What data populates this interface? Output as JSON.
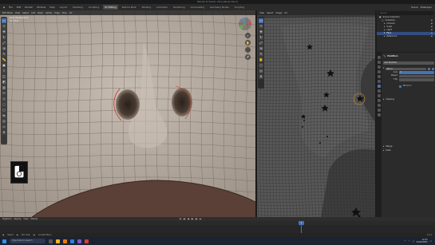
{
  "window": {
    "title": "Blender [C:\\Users\\...\\Face_Retopo.blend]"
  },
  "topbar": {
    "menus": [
      "File",
      "Edit",
      "Render",
      "Window",
      "Help"
    ],
    "workspaces": [
      "Layout",
      "Modeling",
      "Sculpting",
      "UV Editing",
      "Texture Paint",
      "Shading",
      "Animation",
      "Rendering",
      "Compositing",
      "Geometry Nodes",
      "Scripting"
    ],
    "active_workspace": "UV Editing",
    "scene_label": "Scene",
    "view_layer_label": "ViewLayer"
  },
  "viewport": {
    "header_items": [
      "Edit Mode",
      "View",
      "Select",
      "Add",
      "Mesh",
      "Vertex",
      "Edge",
      "Face",
      "UV"
    ],
    "overlay_line1": "User Perspective",
    "overlay_line2": "(1) Face",
    "colors": {
      "skin": "#b6ab9f",
      "wire": "#6e655c",
      "seam": "#c0392b",
      "mouth": "#5a4036"
    }
  },
  "uv_editor": {
    "header_items": [
      "View",
      "Select",
      "Image",
      "UV"
    ],
    "colors": {
      "background": "#3d3d3d",
      "island": "#555555",
      "pin": "#111111"
    }
  },
  "outliner": {
    "search_placeholder": "Search",
    "rows": [
      {
        "label": "Scene Collection",
        "selected": false
      },
      {
        "label": "Collection",
        "selected": false
      },
      {
        "label": "Camera",
        "selected": false
      },
      {
        "label": "Cube",
        "selected": false
      },
      {
        "label": "Light",
        "selected": false
      },
      {
        "label": "Face",
        "selected": true
      },
      {
        "label": "Reference",
        "selected": false
      }
    ]
  },
  "properties": {
    "object_name": "Modifiers",
    "rows": [
      {
        "label": "Add Modifier",
        "value": ""
      },
      {
        "label": "Mirror",
        "value": ""
      },
      {
        "label": "Axis",
        "value": "X"
      },
      {
        "label": "Bisect",
        "value": ""
      },
      {
        "label": "Flip",
        "value": ""
      },
      {
        "label": "Mirror U",
        "value": ""
      }
    ],
    "sections": [
      "Clipping",
      "Merge",
      "Data"
    ]
  },
  "timeline": {
    "header_items": [
      "Playback",
      "Keying",
      "View",
      "Marker"
    ],
    "current_frame": "1",
    "ruler_labels": [
      "0",
      "20",
      "40",
      "60",
      "80",
      "100",
      "120",
      "140",
      "160",
      "180",
      "200",
      "220",
      "240"
    ]
  },
  "statusbar": {
    "items": [
      "Select",
      "Pan View",
      "Context Menu"
    ],
    "version": "3.4.1"
  },
  "taskbar": {
    "search_placeholder": "Type here to search",
    "time": "12:43",
    "date": "01/02/2023"
  }
}
